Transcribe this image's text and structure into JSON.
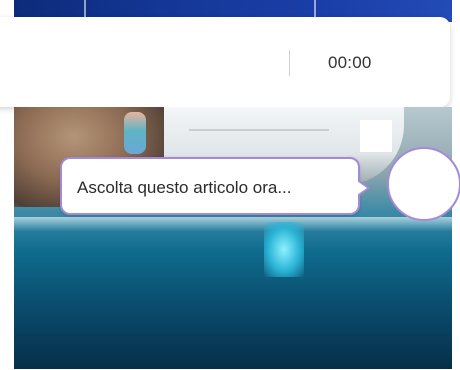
{
  "player": {
    "time": "00:00"
  },
  "tooltip": {
    "text": "Ascolta questo articolo ora..."
  },
  "colors": {
    "accent": "#a48ad6",
    "text": "#333333"
  },
  "icons": {
    "play": "circle-play-icon"
  }
}
